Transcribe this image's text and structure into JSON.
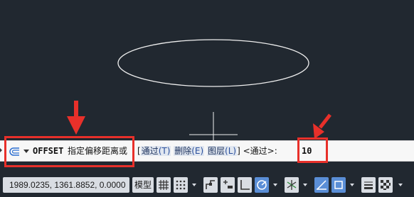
{
  "drawing": {
    "shapes": [
      "ellipse",
      "crosshair-cursor"
    ]
  },
  "command_line": {
    "command": "OFFSET",
    "prompt": "指定偏移距离或",
    "bracket_open": "[",
    "bracket_close": "]",
    "options": [
      {
        "label": "通过",
        "key": "(T)"
      },
      {
        "label": "删除",
        "key": "(E)"
      },
      {
        "label": "图层",
        "key": "(L)"
      }
    ],
    "default_label": "<通过>:",
    "input_value": "10"
  },
  "status_bar": {
    "coordinates": "1989.0235, 1361.8852, 0.0000",
    "model_label": "模型",
    "icons": [
      "grid-icon",
      "snap-icon",
      "infer-constraints-icon",
      "dynamic-input-icon",
      "ortho-icon",
      "polar-tracking-icon",
      "isodraft-icon",
      "object-snap-tracking-icon",
      "object-snap-icon",
      "lineweight-icon",
      "transparency-icon",
      "selection-cycling-icon",
      "3d-osnap-icon",
      "dynamic-ucs-icon"
    ]
  },
  "annotations": {
    "highlight_color": "#e8302a"
  }
}
